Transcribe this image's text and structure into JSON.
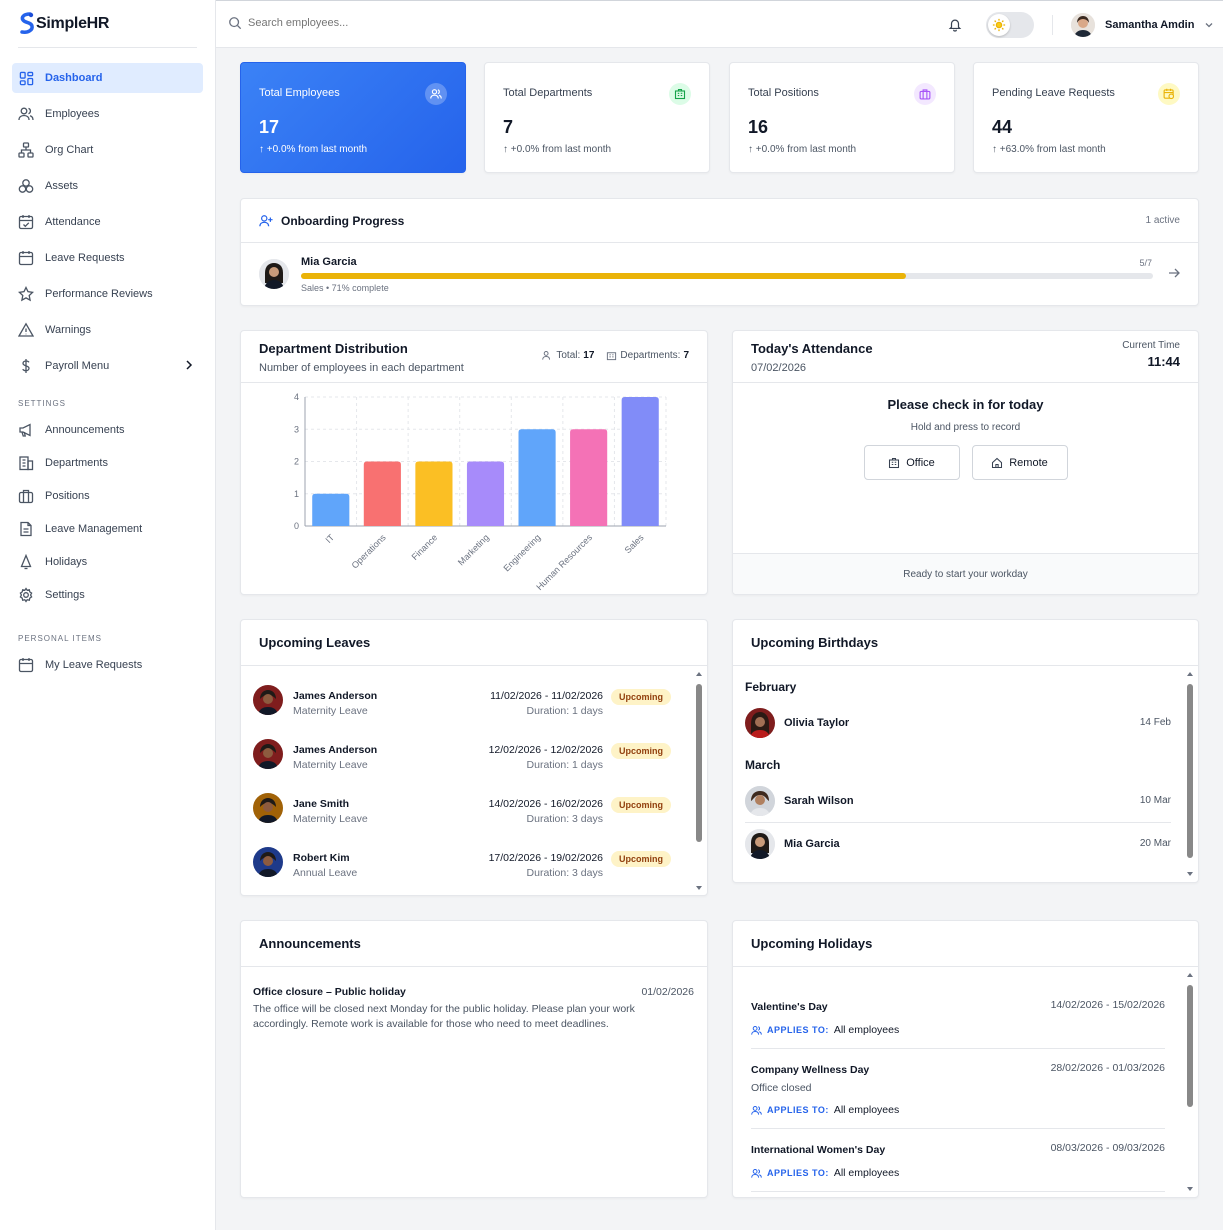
{
  "app": {
    "name": "SimpleHR"
  },
  "search": {
    "placeholder": "Search employees..."
  },
  "user": {
    "name": "Samantha Amdin"
  },
  "sidebar": {
    "items": [
      {
        "label": "Dashboard",
        "icon": "dashboard-icon"
      },
      {
        "label": "Employees",
        "icon": "users-icon"
      },
      {
        "label": "Org Chart",
        "icon": "org-chart-icon"
      },
      {
        "label": "Assets",
        "icon": "assets-icon"
      },
      {
        "label": "Attendance",
        "icon": "calendar-check-icon"
      },
      {
        "label": "Leave Requests",
        "icon": "calendar-icon"
      },
      {
        "label": "Performance Reviews",
        "icon": "star-icon"
      },
      {
        "label": "Warnings",
        "icon": "warning-icon"
      },
      {
        "label": "Payroll Menu",
        "icon": "dollar-icon"
      }
    ],
    "settings_label": "SETTINGS",
    "settings_items": [
      {
        "label": "Announcements",
        "icon": "megaphone-icon"
      },
      {
        "label": "Departments",
        "icon": "building-icon"
      },
      {
        "label": "Positions",
        "icon": "briefcase-icon"
      },
      {
        "label": "Leave Management",
        "icon": "document-icon"
      },
      {
        "label": "Holidays",
        "icon": "bell-icon"
      },
      {
        "label": "Settings",
        "icon": "gear-icon"
      }
    ],
    "personal_label": "PERSONAL ITEMS",
    "personal_items": [
      {
        "label": "My Leave Requests",
        "icon": "calendar-icon"
      }
    ]
  },
  "stats": [
    {
      "label": "Total Employees",
      "value": "17",
      "change": "↑ +0.0% from last month",
      "color": "#2563eb"
    },
    {
      "label": "Total Departments",
      "value": "7",
      "change": "↑ +0.0% from last month",
      "color": "#16a34a"
    },
    {
      "label": "Total Positions",
      "value": "16",
      "change": "↑ +0.0% from last month",
      "color": "#a855f7"
    },
    {
      "label": "Pending Leave Requests",
      "value": "44",
      "change": "↑ +63.0% from last month",
      "color": "#eab308"
    }
  ],
  "onboarding": {
    "title": "Onboarding Progress",
    "active": "1 active",
    "employee": "Mia Garcia",
    "steps": "5/7",
    "detail": "Sales • 71% complete",
    "progress": 0.71
  },
  "department": {
    "title": "Department Distribution",
    "subtitle": "Number of employees in each department",
    "total_label": "Total:",
    "total_value": "17",
    "departments_label": "Departments:",
    "departments_value": "7"
  },
  "chart_data": {
    "type": "bar",
    "categories": [
      "IT",
      "Operations",
      "Finance",
      "Marketing",
      "Engineering",
      "Human Resources",
      "Sales"
    ],
    "values": [
      1,
      2,
      2,
      2,
      3,
      3,
      4
    ],
    "colors": [
      "#60a5fa",
      "#f87171",
      "#fbbf24",
      "#a78bfa",
      "#60a5fa",
      "#f472b6",
      "#818cf8"
    ],
    "yticks": [
      0,
      1,
      2,
      3,
      4
    ],
    "ylim": [
      0,
      4
    ],
    "grid": true
  },
  "attendance": {
    "title": "Today's Attendance",
    "date": "07/02/2026",
    "time_label": "Current Time",
    "time": "11:44",
    "prompt": "Please check in for today",
    "hint": "Hold and press to record",
    "office": "Office",
    "remote": "Remote",
    "status": "Ready to start your workday"
  },
  "leaves": {
    "title": "Upcoming Leaves",
    "items": [
      {
        "name": "James Anderson",
        "type": "Maternity Leave",
        "dates": "11/02/2026 - 11/02/2026",
        "duration": "Duration: 1 days",
        "status": "Upcoming"
      },
      {
        "name": "James Anderson",
        "type": "Maternity Leave",
        "dates": "12/02/2026 - 12/02/2026",
        "duration": "Duration: 1 days",
        "status": "Upcoming"
      },
      {
        "name": "Jane Smith",
        "type": "Maternity Leave",
        "dates": "14/02/2026 - 16/02/2026",
        "duration": "Duration: 3 days",
        "status": "Upcoming"
      },
      {
        "name": "Robert Kim",
        "type": "Annual Leave",
        "dates": "17/02/2026 - 19/02/2026",
        "duration": "Duration: 3 days",
        "status": "Upcoming"
      }
    ]
  },
  "birthdays": {
    "title": "Upcoming Birthdays",
    "groups": [
      {
        "month": "February",
        "people": [
          {
            "name": "Olivia Taylor",
            "date": "14 Feb"
          }
        ]
      },
      {
        "month": "March",
        "people": [
          {
            "name": "Sarah Wilson",
            "date": "10 Mar"
          },
          {
            "name": "Mia Garcia",
            "date": "20 Mar"
          }
        ]
      }
    ]
  },
  "announcements": {
    "title": "Announcements",
    "items": [
      {
        "title": "Office closure – Public holiday",
        "date": "01/02/2026",
        "body": "The office will be closed next Monday for the public holiday. Please plan your work accordingly. Remote work is available for those who need to meet deadlines."
      }
    ]
  },
  "holidays": {
    "title": "Upcoming Holidays",
    "applies_label": "APPLIES TO:",
    "items": [
      {
        "name": "Valentine's Day",
        "dates": "14/02/2026 - 15/02/2026",
        "note": "",
        "applies": "All employees"
      },
      {
        "name": "Company Wellness Day",
        "dates": "28/02/2026 - 01/03/2026",
        "note": "Office closed",
        "applies": "All employees"
      },
      {
        "name": "International Women's Day",
        "dates": "08/03/2026 - 09/03/2026",
        "note": "",
        "applies": "All employees"
      }
    ]
  }
}
